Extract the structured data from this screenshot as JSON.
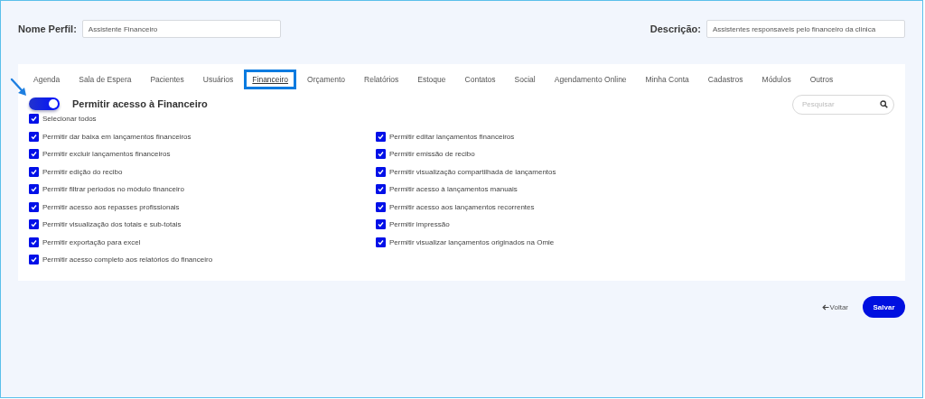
{
  "profile": {
    "name_label": "Nome Perfil:",
    "name_value": "Assistente Financeiro",
    "description_label": "Descrição:",
    "description_value": "Assistentes responsaveis pelo financeiro da clinica"
  },
  "tabs": [
    {
      "label": "Agenda",
      "selected": false
    },
    {
      "label": "Sala de Espera",
      "selected": false
    },
    {
      "label": "Pacientes",
      "selected": false
    },
    {
      "label": "Usuários",
      "selected": false
    },
    {
      "label": "Financeiro",
      "selected": true
    },
    {
      "label": "Orçamento",
      "selected": false
    },
    {
      "label": "Relatórios",
      "selected": false
    },
    {
      "label": "Estoque",
      "selected": false
    },
    {
      "label": "Contatos",
      "selected": false
    },
    {
      "label": "Social",
      "selected": false
    },
    {
      "label": "Agendamento Online",
      "selected": false
    },
    {
      "label": "Minha Conta",
      "selected": false
    },
    {
      "label": "Cadastros",
      "selected": false
    },
    {
      "label": "Módulos",
      "selected": false
    },
    {
      "label": "Outros",
      "selected": false
    }
  ],
  "toggle": {
    "label": "Permitir acesso à Financeiro",
    "on": true
  },
  "search": {
    "placeholder": "Pesquisar"
  },
  "select_all": {
    "label": "Selecionar todos",
    "checked": true
  },
  "permissions_left": [
    {
      "label": "Permitir dar baixa em lançamentos financeiros",
      "checked": true
    },
    {
      "label": "Permitir excluir lançamentos financeiros",
      "checked": true
    },
    {
      "label": "Permitir edição do recibo",
      "checked": true
    },
    {
      "label": "Permitir filtrar periodos no módulo financeiro",
      "checked": true
    },
    {
      "label": "Permitir acesso aos repasses profissionais",
      "checked": true
    },
    {
      "label": "Permitir visualização dos totais e sub-totais",
      "checked": true
    },
    {
      "label": "Permitir exportação para excel",
      "checked": true
    },
    {
      "label": "Permitir acesso completo aos relatórios do financeiro",
      "checked": true
    }
  ],
  "permissions_right": [
    {
      "label": "Permitir editar lançamentos financeiros",
      "checked": true
    },
    {
      "label": "Permitir emissão de recibo",
      "checked": true
    },
    {
      "label": "Permitir visualização compartilhada de lançamentos",
      "checked": true
    },
    {
      "label": "Permitir acesso à lançamentos manuais",
      "checked": true
    },
    {
      "label": "Permitir acesso aos lançamentos recorrentes",
      "checked": true
    },
    {
      "label": "Permitir impressão",
      "checked": true
    },
    {
      "label": "Permitir visualizar lançamentos originados na Omie",
      "checked": true
    }
  ],
  "buttons": {
    "back": "Voltar",
    "save": "Salvar"
  }
}
